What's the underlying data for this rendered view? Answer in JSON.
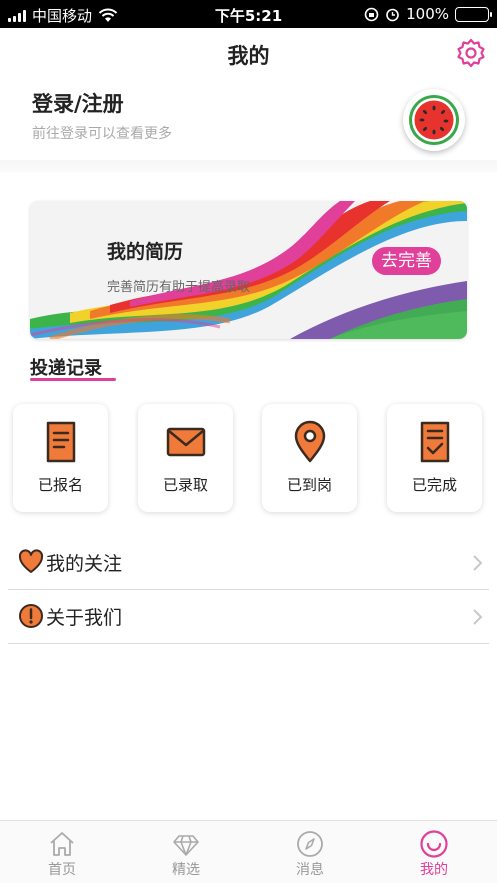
{
  "status_bar": {
    "carrier": "中国移动",
    "time": "下午5:21",
    "battery": "100%",
    "battery_level": 1.0
  },
  "header": {
    "title": "我的",
    "settings_icon": "gear-icon"
  },
  "profile": {
    "login_label": "登录/注册",
    "login_hint": "前往登录可以查看更多",
    "avatar_icon": "watermelon-icon"
  },
  "banner": {
    "title": "我的简历",
    "subtitle": "完善简历有助于提高录取",
    "button_label": "去完善"
  },
  "records": {
    "title": "投递记录",
    "items": [
      {
        "label": "已报名",
        "icon": "document-icon"
      },
      {
        "label": "已录取",
        "icon": "envelope-icon"
      },
      {
        "label": "已到岗",
        "icon": "location-pin-icon"
      },
      {
        "label": "已完成",
        "icon": "checklist-icon"
      }
    ]
  },
  "menu": {
    "items": [
      {
        "label": "我的关注",
        "icon": "heart-icon"
      },
      {
        "label": "关于我们",
        "icon": "exclamation-icon"
      }
    ]
  },
  "tabbar": {
    "items": [
      {
        "label": "首页",
        "icon": "home-icon"
      },
      {
        "label": "精选",
        "icon": "diamond-icon"
      },
      {
        "label": "消息",
        "icon": "compass-icon"
      },
      {
        "label": "我的",
        "icon": "smile-icon"
      }
    ],
    "active_index": 3
  },
  "colors": {
    "accent": "#e0409a",
    "icon_orange": "#f07a3a",
    "icon_dark": "#3a2a20"
  }
}
